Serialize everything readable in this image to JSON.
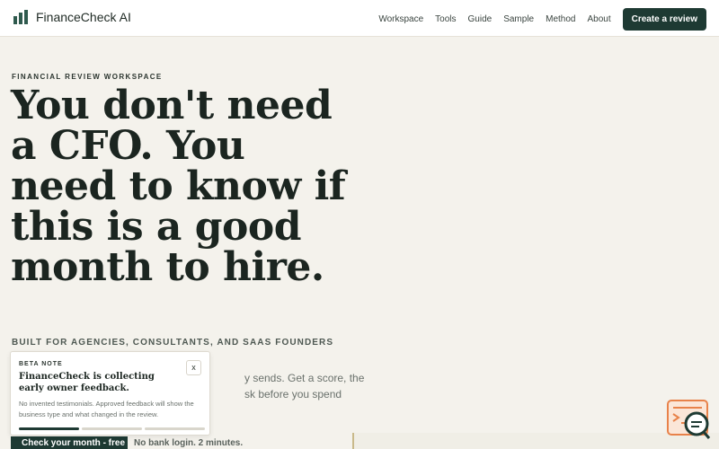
{
  "header": {
    "brand": "FinanceCheck AI",
    "nav": [
      "Workspace",
      "Tools",
      "Guide",
      "Sample",
      "Method",
      "About"
    ],
    "cta": "Create a review"
  },
  "hero": {
    "eyebrow": "FINANCIAL REVIEW WORKSPACE",
    "headline": "You don't need a CFO. You need to know if this is a good month to hire.",
    "subhead": "BUILT FOR AGENCIES, CONSULTANTS, AND SAAS FOUNDERS",
    "lead_line_1": "y sends. Get a score, the",
    "lead_line_2": "sk before you spend",
    "start_button": "Check your month - free",
    "reassurance": "No bank login. 2 minutes."
  },
  "beta_note": {
    "label": "BETA NOTE",
    "title": "FinanceCheck is collecting early owner feedback.",
    "body": "No invented testimonials. Approved feedback will show the business type and what changed in the review.",
    "close": "x",
    "progress_active": 1,
    "progress_total": 3
  },
  "colors": {
    "accent": "#1e3a33",
    "background": "#f4f2ec",
    "help_widget": "#e8824a"
  },
  "icons": {
    "logo": "bar-chart-icon",
    "help": "search-chat-icon"
  }
}
